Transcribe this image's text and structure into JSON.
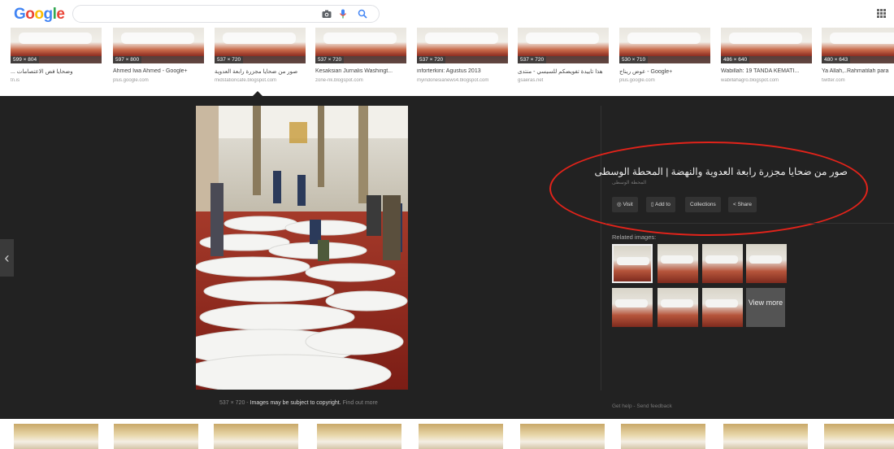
{
  "header": {
    "logo": "Google",
    "logo_letters": [
      {
        "ch": "G",
        "color": "#4285f4"
      },
      {
        "ch": "o",
        "color": "#ea4335"
      },
      {
        "ch": "o",
        "color": "#fbbc05"
      },
      {
        "ch": "g",
        "color": "#4285f4"
      },
      {
        "ch": "l",
        "color": "#34a853"
      },
      {
        "ch": "e",
        "color": "#ea4335"
      }
    ],
    "search_value": ""
  },
  "strip": [
    {
      "dim": "599 × 804",
      "title": "... وضحايا فض الاعتصامات",
      "src": "tn.is"
    },
    {
      "dim": "597 × 800",
      "title": "Ahmed Iwa Ahmed - Google+",
      "src": "plus.google.com"
    },
    {
      "dim": "537 × 720",
      "title": "صور من ضحايا مجزرة رابعة العدوية",
      "src": "midstationcafe.blogspot.com"
    },
    {
      "dim": "537 × 720",
      "title": "Kesaksian Jurnalis Washingt...",
      "src": "zone-nk.blogspot.com"
    },
    {
      "dim": "537 × 720",
      "title": "inforterkini: Agustus 2013",
      "src": "myindonesianews4.blogspot.com"
    },
    {
      "dim": "537 × 720",
      "title": "هذا تاييدة تفويضكم للسيسي - منتدى",
      "src": "gsaeras.net"
    },
    {
      "dim": "530 × 710",
      "title": "عوض ريناج - Google+",
      "src": "plus.google.com"
    },
    {
      "dim": "486 × 640",
      "title": "Wabillah: 19 TANDA KEMATI...",
      "src": "wabillahagro.blogspot.com"
    },
    {
      "dim": "480 × 643",
      "title": "Ya Allah,..Rahmatilah para",
      "src": "twitter.com"
    }
  ],
  "panel": {
    "caption_dim": "537 × 720",
    "caption_sep": " - ",
    "caption_notice": "Images may be subject to copyright.",
    "caption_link": "Find out more",
    "title": "صور من ضحايا مجزرة رابعة العدوية والنهضة | المحطة الوسطى",
    "subtitle": "المحطة الوسطى",
    "buttons": {
      "visit": "Visit",
      "add": "Add to",
      "collections": "Collections",
      "share": "Share"
    },
    "related_label": "Related images:",
    "view_more": "View more",
    "footer": {
      "help": "Get help",
      "sep": " - ",
      "feedback": "Send feedback"
    },
    "prev": "‹"
  }
}
